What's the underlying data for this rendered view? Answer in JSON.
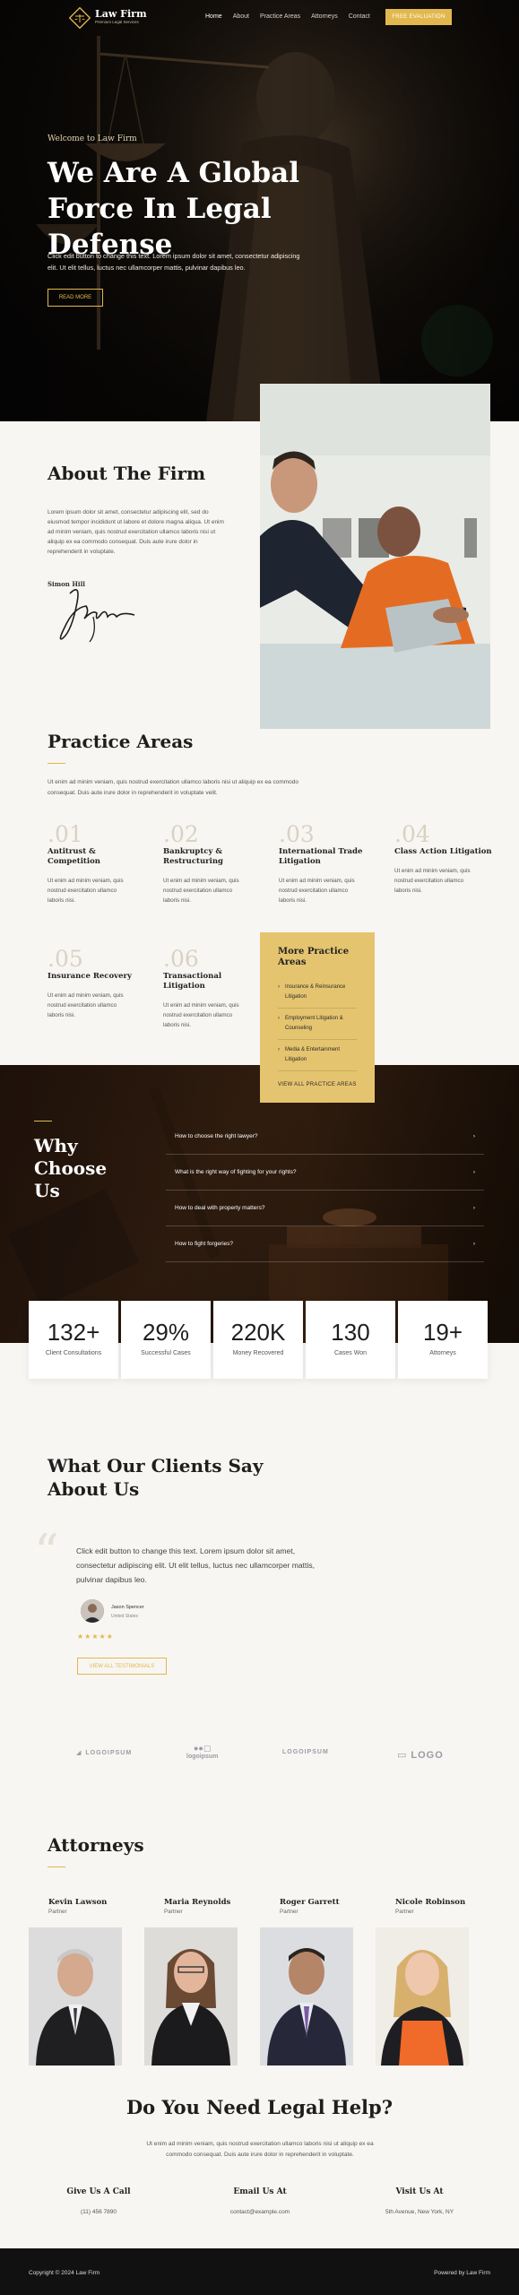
{
  "header": {
    "brand": "Law Firm",
    "tagline": "Premium Legal Services",
    "nav": [
      "Home",
      "About",
      "Practice Areas",
      "Attorneys",
      "Contact"
    ],
    "cta": "FREE EVALUATION"
  },
  "hero": {
    "welcome": "Welcome to Law Firm",
    "title": "We Are A Global Force In Legal Defense",
    "text": "Click edit button to change this text. Lorem ipsum dolor sit amet, consectetur adipiscing elit. Ut elit tellus, luctus nec ullamcorper mattis, pulvinar dapibus leo.",
    "button": "READ MORE"
  },
  "about": {
    "title": "About The Firm",
    "text": "Lorem ipsum dolor sit amet, consectetur adipiscing elit, sed do eiusmod tempor incididunt ut labore et dolore magna aliqua. Ut enim ad minim veniam, quis nostrud exercitation ullamco laboris nisi ut aliquip ex ea commodo consequat. Duis aute irure dolor in reprehenderit in voluptate.",
    "name": "Simon Hill"
  },
  "practice": {
    "title": "Practice Areas",
    "intro": "Ut enim ad minim veniam, quis nostrud exercitation ullamco laboris nisi ut aliquip ex ea commodo consequat. Duis aute irure dolor in reprehenderit in voluptate velit.",
    "areas": [
      {
        "num": ".01",
        "name": "Antitrust & Competition",
        "text": "Ut enim ad minim veniam, quis nostrud exercitation ullamco laboris nisi."
      },
      {
        "num": ".02",
        "name": "Bankruptcy & Restructuring",
        "text": "Ut enim ad minim veniam, quis nostrud exercitation ullamco laboris nisi."
      },
      {
        "num": ".03",
        "name": "International Trade Litigation",
        "text": "Ut enim ad minim veniam, quis nostrud exercitation ullamco laboris nisi."
      },
      {
        "num": ".04",
        "name": "Class Action Litigation",
        "text": "Ut enim ad minim veniam, quis nostrud exercitation ullamco laboris nisi."
      },
      {
        "num": ".05",
        "name": "Insurance Recovery",
        "text": "Ut enim ad minim veniam, quis nostrud exercitation ullamco laboris nisi."
      },
      {
        "num": ".06",
        "name": "Transactional Litigation",
        "text": "Ut enim ad minim veniam, quis nostrud exercitation ullamco laboris nisi."
      }
    ],
    "more": {
      "title": "More Practice Areas",
      "items": [
        "Insurance & Reinsurance Litigation",
        "Employment Litigation & Counseling",
        "Media & Entertainment Litigation"
      ],
      "link": "VIEW ALL PRACTICE AREAS"
    }
  },
  "why": {
    "title": "Why Choose Us",
    "questions": [
      "How to choose the right lawyer?",
      "What is the right way of fighting for your rights?",
      "How to deal with property matters?",
      "How to fight forgeries?"
    ]
  },
  "stats": [
    {
      "value": "132+",
      "label": "Client Consultations"
    },
    {
      "value": "29%",
      "label": "Successful Cases"
    },
    {
      "value": "220K",
      "label": "Money Recovered"
    },
    {
      "value": "130",
      "label": "Cases Won"
    },
    {
      "value": "19+",
      "label": "Attorneys"
    }
  ],
  "testimonials": {
    "title": "What Our Clients Say About Us",
    "quote": "Click edit button to change this text. Lorem ipsum dolor sit amet, consectetur adipiscing elit. Ut elit tellus, luctus nec ullamcorper mattis, pulvinar dapibus leo.",
    "name": "Jason Spencer",
    "location": "United States",
    "rating": 5,
    "stars": "★★★★★",
    "button": "VIEW ALL TESTIMONIALS"
  },
  "logos": [
    "LOGOIPSUM",
    "logoipsum",
    "LOGOIPSUM",
    "LOGO"
  ],
  "attorneys": {
    "title": "Attorneys",
    "people": [
      {
        "name": "Kevin Lawson",
        "role": "Partner"
      },
      {
        "name": "Maria Reynolds",
        "role": "Partner"
      },
      {
        "name": "Roger Garrett",
        "role": "Partner"
      },
      {
        "name": "Nicole Robinson",
        "role": "Partner"
      }
    ]
  },
  "cta": {
    "title": "Do You Need Legal Help?",
    "text": "Ut enim ad minim veniam, quis nostrud exercitation ullamco laboris nisi ut aliquip ex ea commodo consequat. Duis aute irure dolor in reprehenderit in voluptate.",
    "contacts": [
      {
        "title": "Give Us A Call",
        "value": "(11) 456 7890"
      },
      {
        "title": "Email Us At",
        "value": "contact@example.com"
      },
      {
        "title": "Visit Us At",
        "value": "5th Avenue, New York, NY"
      }
    ]
  },
  "footer": {
    "copyright": "Copyright © 2024 Law Firm",
    "powered": "Powered by Law Firm"
  },
  "colors": {
    "accent": "#e2b84e",
    "dark": "#111111",
    "bg": "#f8f6f2"
  }
}
